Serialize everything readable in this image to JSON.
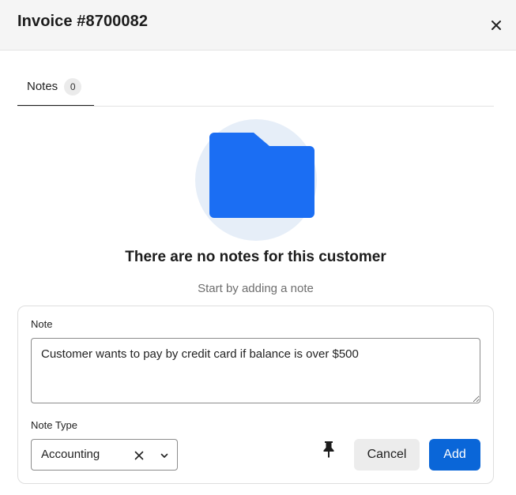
{
  "header": {
    "title": "Invoice #8700082",
    "close_icon": "close-icon"
  },
  "tabs": [
    {
      "label": "Notes",
      "count": "0",
      "active": true
    }
  ],
  "empty_state": {
    "icon": "folder-icon",
    "title": "There are no notes for this customer",
    "subtitle": "Start by adding a note"
  },
  "form": {
    "note_label": "Note",
    "note_value": "Customer wants to pay by credit card if balance is over $500",
    "type_label": "Note Type",
    "type_value": "Accounting",
    "pin_icon": "pin-icon",
    "cancel_label": "Cancel",
    "add_label": "Add"
  },
  "colors": {
    "accent": "#0a66d8",
    "folder": "#1b6ef3",
    "empty_circle": "#e6eef8",
    "header_bg": "#f5f5f5",
    "cancel_bg": "#ececec"
  }
}
